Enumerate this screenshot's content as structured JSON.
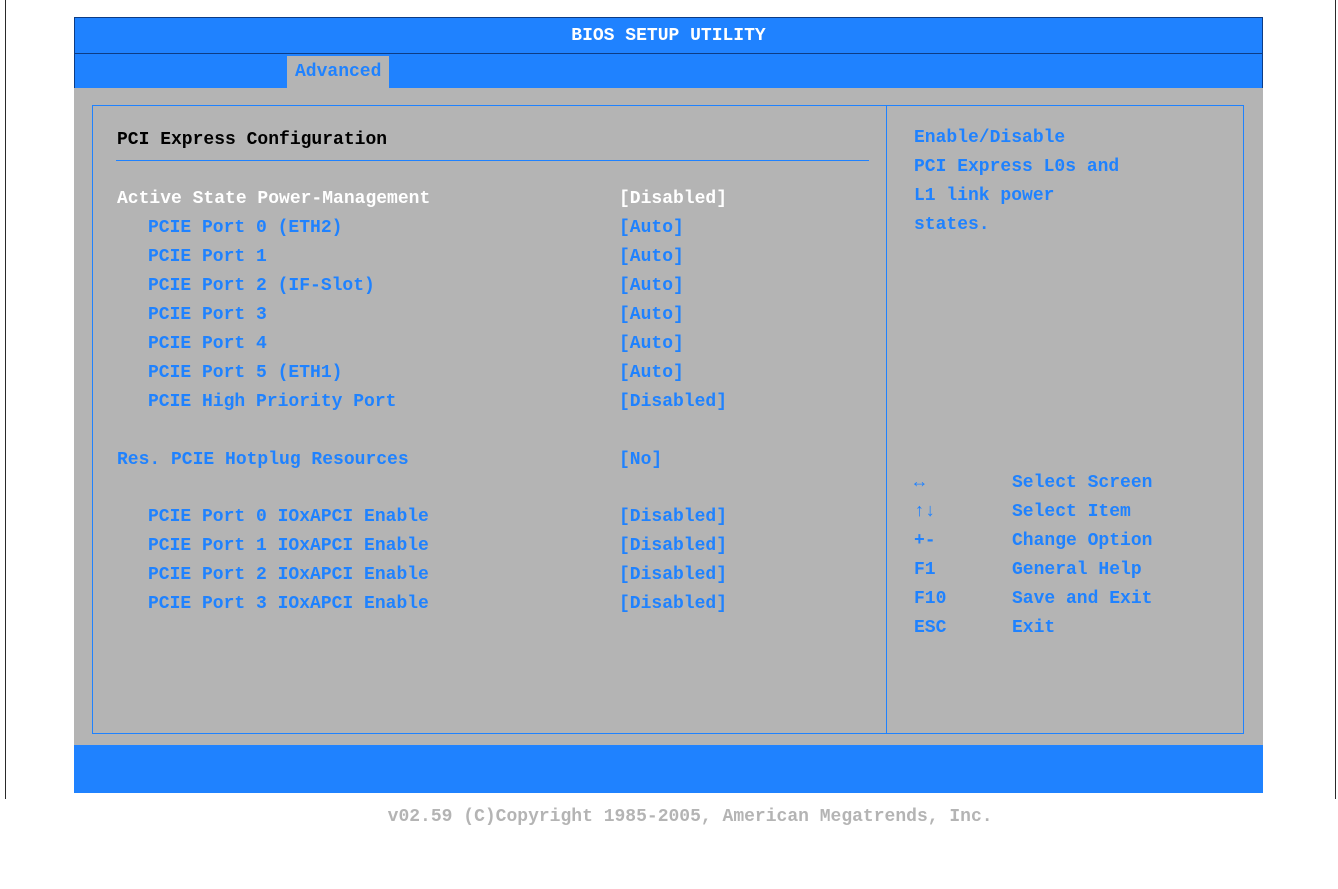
{
  "header": {
    "title": "BIOS SETUP UTILITY",
    "active_tab": "Advanced"
  },
  "main": {
    "section_title": "PCI Express Configuration",
    "items": [
      {
        "label": "Active State Power-Management",
        "value": "[Disabled]",
        "selected": true,
        "indent": false
      },
      {
        "label": "PCIE Port 0 (ETH2)",
        "value": "[Auto]",
        "selected": false,
        "indent": true
      },
      {
        "label": "PCIE Port 1",
        "value": "[Auto]",
        "selected": false,
        "indent": true
      },
      {
        "label": "PCIE Port 2 (IF-Slot)",
        "value": "[Auto]",
        "selected": false,
        "indent": true
      },
      {
        "label": "PCIE Port 3",
        "value": "[Auto]",
        "selected": false,
        "indent": true
      },
      {
        "label": "PCIE Port 4",
        "value": "[Auto]",
        "selected": false,
        "indent": true
      },
      {
        "label": "PCIE Port 5 (ETH1)",
        "value": "[Auto]",
        "selected": false,
        "indent": true
      },
      {
        "label": "PCIE High Priority Port",
        "value": "[Disabled]",
        "selected": false,
        "indent": true
      },
      {
        "label": "Res. PCIE Hotplug Resources",
        "value": "[No]",
        "selected": false,
        "indent": false
      },
      {
        "label": "PCIE Port 0 IOxAPCI Enable",
        "value": "[Disabled]",
        "selected": false,
        "indent": true
      },
      {
        "label": "PCIE Port 1 IOxAPCI Enable",
        "value": "[Disabled]",
        "selected": false,
        "indent": true
      },
      {
        "label": "PCIE Port 2 IOxAPCI Enable",
        "value": "[Disabled]",
        "selected": false,
        "indent": true
      },
      {
        "label": "PCIE Port 3 IOxAPCI Enable",
        "value": "[Disabled]",
        "selected": false,
        "indent": true
      }
    ]
  },
  "help": {
    "lines": [
      "Enable/Disable",
      "PCI Express L0s and",
      "L1 link power",
      "states."
    ]
  },
  "keys": [
    {
      "key": "↔",
      "key_icon": "left-right-arrow-icon",
      "desc": "Select Screen"
    },
    {
      "key": "↑↓",
      "key_icon": "up-down-arrow-icon",
      "desc": "Select Item"
    },
    {
      "key": "+-",
      "desc": "Change Option"
    },
    {
      "key": "F1",
      "desc": "General Help"
    },
    {
      "key": "F10",
      "desc": "Save and Exit"
    },
    {
      "key": "ESC",
      "desc": "Exit"
    }
  ],
  "footer": {
    "copyright": "v02.59 (C)Copyright 1985-2005, American Megatrends, Inc."
  },
  "colors": {
    "bar_blue": "#1f82ff",
    "panel_gray": "#b4b4b4",
    "selected_text": "#ffffff",
    "normal_text": "#1f82ff",
    "title_text": "#000000"
  }
}
